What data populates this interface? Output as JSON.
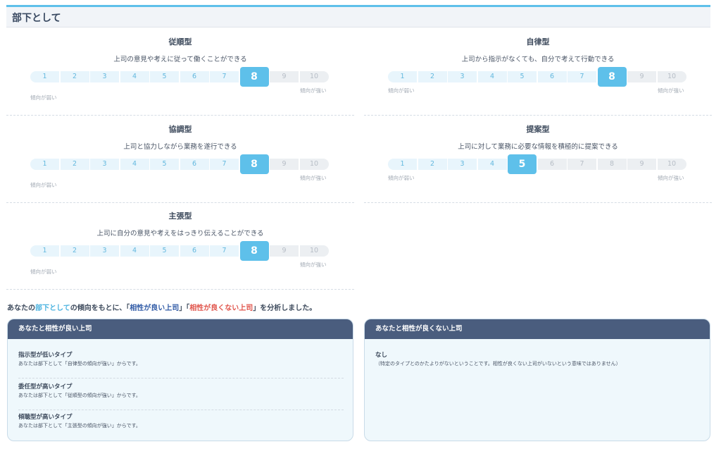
{
  "header": {
    "title": "部下として"
  },
  "traits": [
    {
      "name": "従順型",
      "description": "上司の意見や考えに従って働くことができる",
      "score": 8
    },
    {
      "name": "自律型",
      "description": "上司から指示がなくても、自分で考えて行動できる",
      "score": 8
    },
    {
      "name": "協調型",
      "description": "上司と協力しながら業務を遂行できる",
      "score": 8
    },
    {
      "name": "提案型",
      "description": "上司に対して業務に必要な情報を積極的に提案できる",
      "score": 5
    },
    {
      "name": "主張型",
      "description": "上司に自分の意見や考えをはっきり伝えることができる",
      "score": 8
    }
  ],
  "scale": {
    "numbers": [
      "1",
      "2",
      "3",
      "4",
      "5",
      "6",
      "7",
      "8",
      "9",
      "10"
    ],
    "low_label": "傾向が弱い",
    "high_label": "傾向が強い"
  },
  "summary": {
    "prefix": "あなたの",
    "role": "部下として",
    "middle": "の傾向をもとに、「",
    "good": "相性が良い上司",
    "sep": "」「",
    "bad": "相性が良くない上司",
    "suffix": "」を分析しました。"
  },
  "good_panel": {
    "title": "あなたと相性が良い上司",
    "items": [
      {
        "title": "指示型が低いタイプ",
        "reason": "あなたは部下として「自律型の傾向が強い」からです。"
      },
      {
        "title": "委任型が高いタイプ",
        "reason": "あなたは部下として「従順型の傾向が強い」からです。"
      },
      {
        "title": "傾聴型が高いタイプ",
        "reason": "あなたは部下として「主張型の傾向が強い」からです。"
      }
    ]
  },
  "bad_panel": {
    "title": "あなたと相性が良くない上司",
    "items": [
      {
        "title": "なし",
        "reason": "（特定のタイプとのかたよりがないということです。相性が良くない上司がいないという意味ではありません）"
      }
    ]
  },
  "colors": {
    "accent": "#5ec0ea",
    "panel_header": "#4a5d7e",
    "good_highlight": "#2f5aa6",
    "bad_highlight": "#e0534a"
  }
}
